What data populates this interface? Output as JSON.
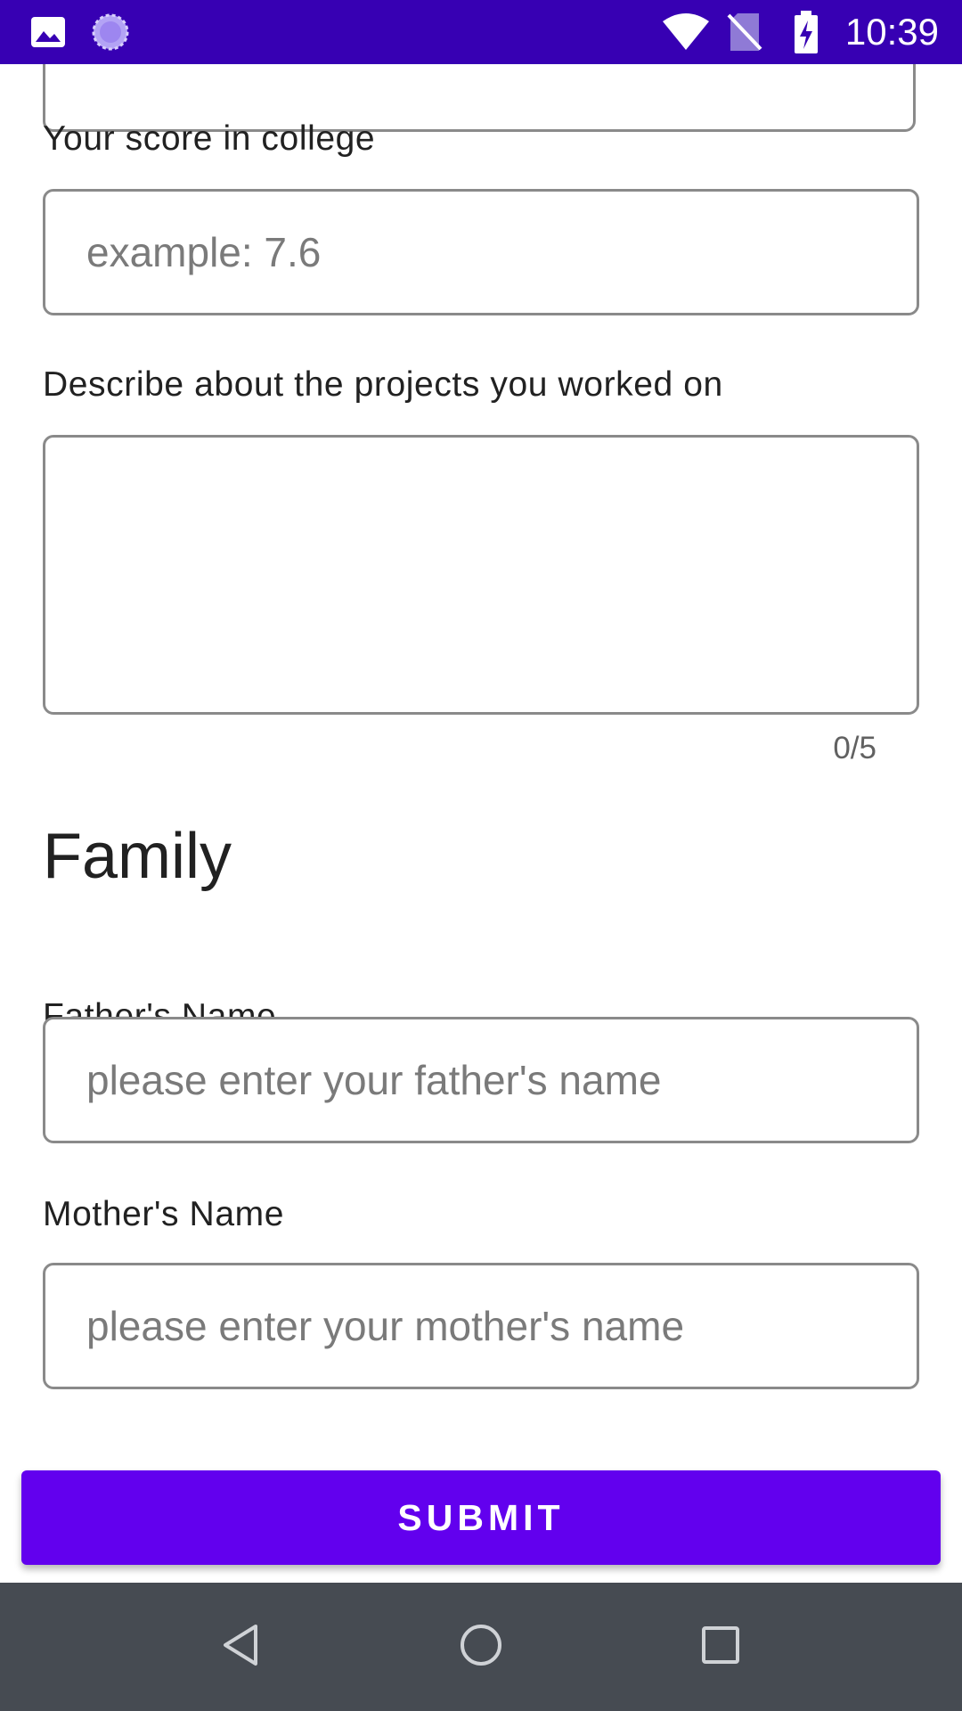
{
  "status_bar": {
    "time": "10:39",
    "background_color": "#3700b3",
    "left_icons": [
      "image-notification-icon",
      "sync-progress-icon"
    ],
    "right_icons": [
      "wifi-icon",
      "no-sim-icon",
      "battery-charging-icon"
    ]
  },
  "form": {
    "score": {
      "label": "Your score in college",
      "placeholder": "example: 7.6",
      "value": ""
    },
    "projects": {
      "label": "Describe about the projects you worked on",
      "value": "",
      "counter": "0/5"
    },
    "family_section": {
      "title": "Family"
    },
    "father": {
      "label": "Father's Name",
      "placeholder": "please enter your father's name",
      "value": ""
    },
    "mother": {
      "label": "Mother's Name",
      "placeholder": "please enter your mother's name",
      "value": ""
    },
    "submit_label": "SUBMIT",
    "accent_color": "#6200ee"
  },
  "nav_bar": {
    "background_color": "#464b52",
    "buttons": [
      "back-icon",
      "home-icon",
      "recents-icon"
    ]
  }
}
